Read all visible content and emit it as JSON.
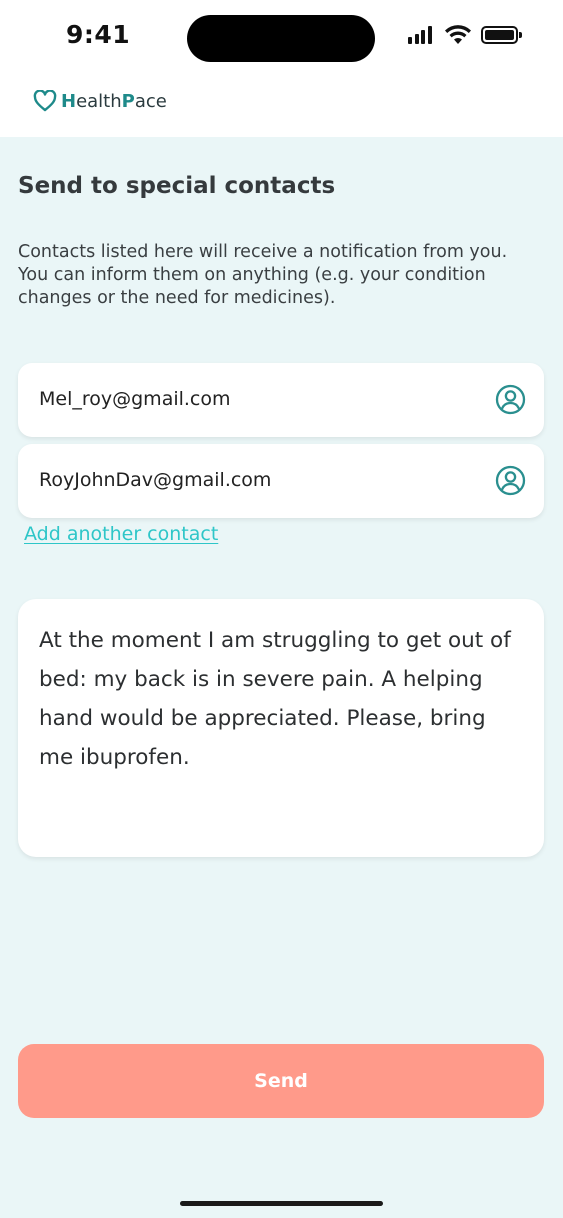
{
  "status_bar": {
    "time": "9:41"
  },
  "brand": {
    "name_h": "H",
    "name_ealth": "ealth",
    "name_p": "P",
    "name_ace": "ace",
    "icon": "heart-outline-icon",
    "accent": "#1e8a8a"
  },
  "page": {
    "title": "Send to special contacts",
    "description_line1": "Contacts listed here will receive a notification from you.",
    "description_line2": "You can inform them on anything (e.g. your condition changes or the need for medicines)."
  },
  "contacts": [
    {
      "email": "Mel_roy@gmail.com",
      "icon": "user-circle-icon"
    },
    {
      "email": "RoyJohnDav@gmail.com",
      "icon": "user-circle-icon"
    }
  ],
  "add_contact_label": "Add another contact",
  "message": {
    "text": "At the moment I am struggling to get out of bed: my back is in severe pain. A helping hand would be appreciated. Please, bring me ibuprofen."
  },
  "send_button": {
    "label": "Send",
    "color": "#ff9a8a"
  },
  "colors": {
    "panel_background": "#eaf6f7",
    "link": "#2ec6c8",
    "icon_teal": "#2a8f8f"
  }
}
